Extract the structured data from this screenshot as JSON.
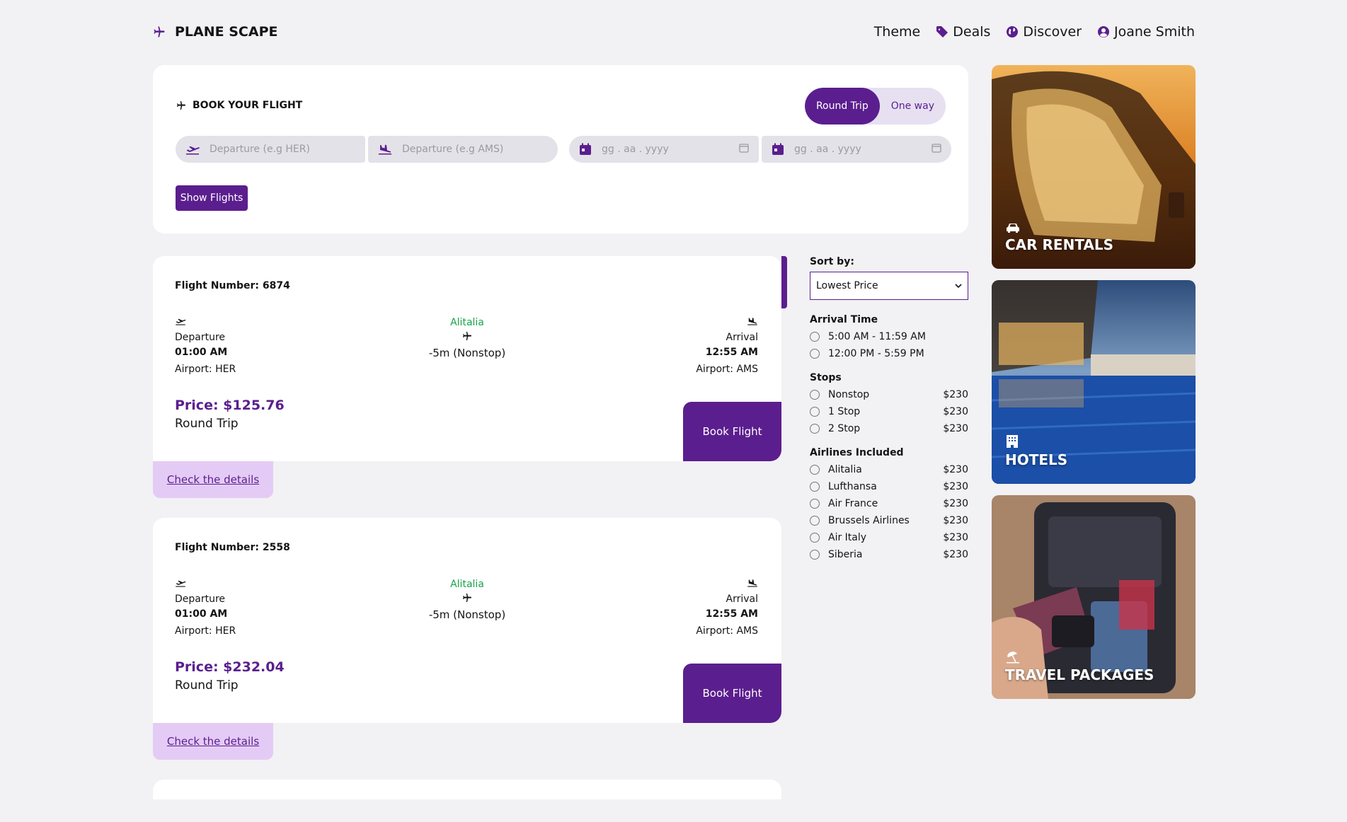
{
  "header": {
    "logo": "PLANE SCAPE",
    "nav": {
      "theme": "Theme",
      "deals": "Deals",
      "discover": "Discover",
      "user": "Joane Smith"
    }
  },
  "booking": {
    "title": "BOOK YOUR FLIGHT",
    "round_trip": "Round Trip",
    "one_way": "One way",
    "from_placeholder": "Departure (e.g HER)",
    "to_placeholder": "Departure (e.g AMS)",
    "date1_placeholder": "gg . aa . yyyy",
    "date2_placeholder": "gg . aa . yyyy",
    "show_flights": "Show Flights"
  },
  "flights": [
    {
      "number_label": "Flight Number: 6874",
      "dep_label": "Departure",
      "dep_time": "01:00 AM",
      "dep_airport": "Airport: HER",
      "airline": "Alitalia",
      "duration": "-5m (Nonstop)",
      "arr_label": "Arrival",
      "arr_time": "12:55 AM",
      "arr_airport": "Airport: AMS",
      "price": "Price: $125.76",
      "trip_type": "Round Trip",
      "book": "Book Flight",
      "details": "Check the details"
    },
    {
      "number_label": "Flight Number: 2558",
      "dep_label": "Departure",
      "dep_time": "01:00 AM",
      "dep_airport": "Airport: HER",
      "airline": "Alitalia",
      "duration": "-5m (Nonstop)",
      "arr_label": "Arrival",
      "arr_time": "12:55 AM",
      "arr_airport": "Airport: AMS",
      "price": "Price: $232.04",
      "trip_type": "Round Trip",
      "book": "Book Flight",
      "details": "Check the details"
    }
  ],
  "filters": {
    "sort_label": "Sort by:",
    "sort_value": "Lowest Price",
    "arrival_title": "Arrival Time",
    "arrival_options": [
      "5:00 AM - 11:59 AM",
      "12:00 PM - 5:59 PM"
    ],
    "stops_title": "Stops",
    "stops": [
      {
        "label": "Nonstop",
        "price": "$230"
      },
      {
        "label": "1 Stop",
        "price": "$230"
      },
      {
        "label": "2 Stop",
        "price": "$230"
      }
    ],
    "airlines_title": "Airlines Included",
    "airlines": [
      {
        "label": "Alitalia",
        "price": "$230"
      },
      {
        "label": "Lufthansa",
        "price": "$230"
      },
      {
        "label": "Air France",
        "price": "$230"
      },
      {
        "label": "Brussels Airlines",
        "price": "$230"
      },
      {
        "label": "Air Italy",
        "price": "$230"
      },
      {
        "label": "Siberia",
        "price": "$230"
      }
    ]
  },
  "promos": {
    "car": "CAR RENTALS",
    "hotels": "HOTELS",
    "travel": "TRAVEL PACKAGES"
  },
  "colors": {
    "accent": "#5b1e8e",
    "airline_green": "#17a449",
    "details_bg": "#e4cbf5",
    "page_bg": "#f2f1f4"
  }
}
